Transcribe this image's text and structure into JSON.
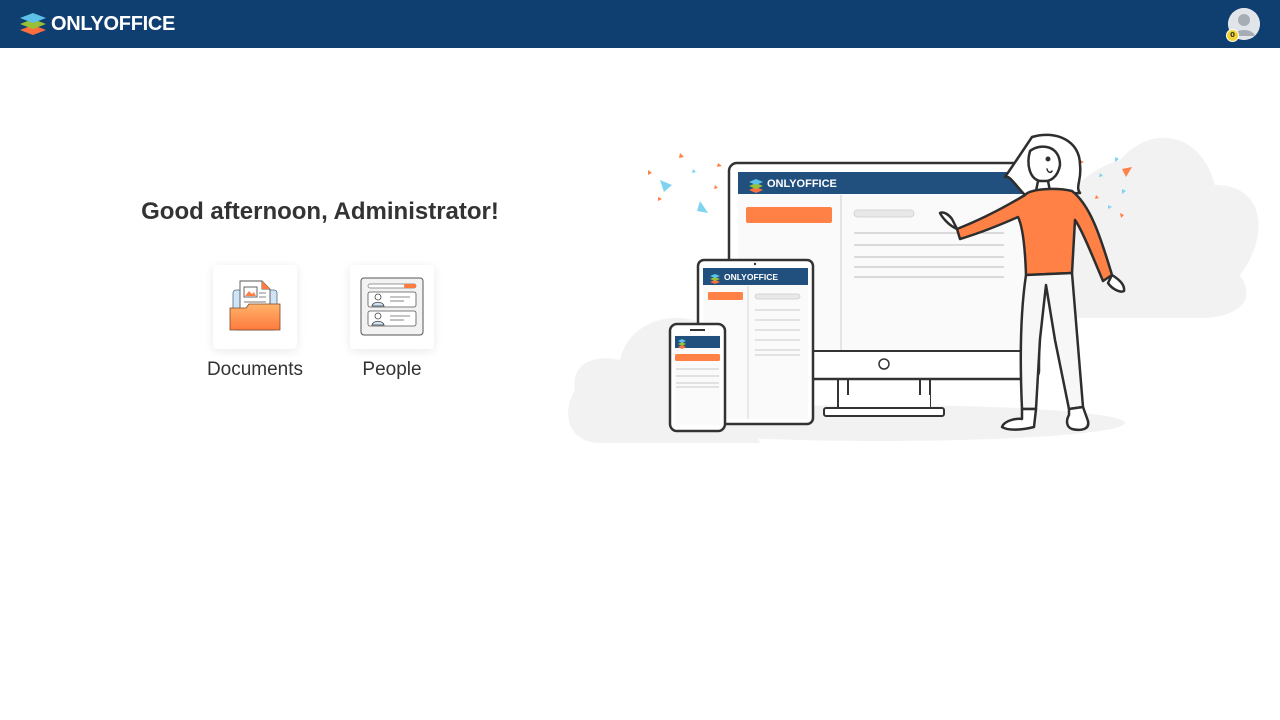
{
  "header": {
    "logo_text": "ONLYOFFICE",
    "avatar_badge": "0",
    "background_color": "#0f3e70"
  },
  "main": {
    "greeting": "Good afternoon, Administrator!",
    "modules": [
      {
        "label": "Documents",
        "icon": "folder-documents-icon"
      },
      {
        "label": "People",
        "icon": "people-cards-icon"
      }
    ]
  },
  "illustration": {
    "monitor_logo": "ONLYOFFICE",
    "tablet_logo": "ONLYOFFICE",
    "accent_color": "#ff8146",
    "screen_header_color": "#22507e"
  }
}
